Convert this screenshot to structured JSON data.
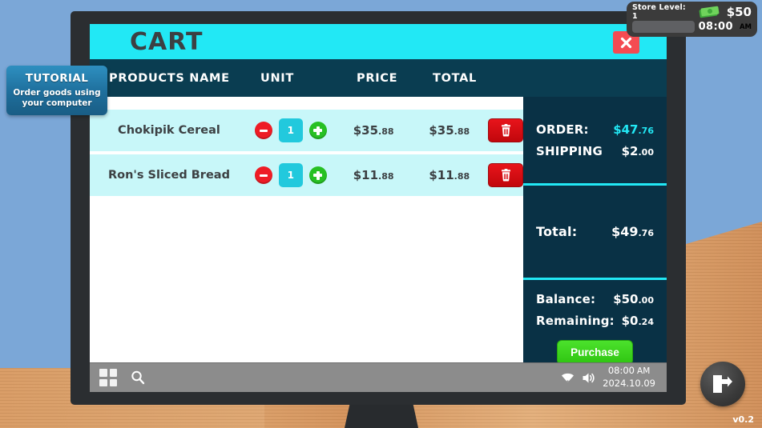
{
  "hud": {
    "store_level": "Store Level: 1",
    "money": "$50",
    "money_icon": "cash-stack-icon",
    "time": "08:00",
    "ampm": "AM",
    "progress_percent": 0
  },
  "tutorial": {
    "title": "TUTORIAL",
    "text": "Order goods using your computer"
  },
  "cart": {
    "title": "CART",
    "close_icon": "close-icon",
    "columns": {
      "name": "PRODUCTS NAME",
      "unit": "UNIT",
      "price": "PRICE",
      "total": "TOTAL"
    },
    "rows": [
      {
        "name": "Chokipik Cereal",
        "qty": "1",
        "price_dollars": "$35",
        "price_cents": ".88",
        "total_dollars": "$35",
        "total_cents": ".88",
        "minus_icon": "minus-circle-icon",
        "plus_icon": "plus-circle-icon",
        "delete_icon": "trash-icon"
      },
      {
        "name": "Ron's Sliced Bread",
        "qty": "1",
        "price_dollars": "$11",
        "price_cents": ".88",
        "total_dollars": "$11",
        "total_cents": ".88",
        "minus_icon": "minus-circle-icon",
        "plus_icon": "plus-circle-icon",
        "delete_icon": "trash-icon"
      }
    ],
    "summary": {
      "order_label": "ORDER:",
      "order_dollars": "$47",
      "order_cents": ".76",
      "shipping_label": "SHIPPING",
      "shipping_dollars": "$2",
      "shipping_cents": ".00",
      "total_label": "Total:",
      "total_dollars": "$49",
      "total_cents": ".76",
      "balance_label": "Balance:",
      "balance_dollars": "$50",
      "balance_cents": ".00",
      "remaining_label": "Remaining:",
      "remaining_dollars": "$0",
      "remaining_cents": ".24",
      "purchase_label": "Purchase",
      "accent_color": "#22E8F5"
    }
  },
  "taskbar": {
    "start_icon": "start-grid-icon",
    "search_icon": "search-icon",
    "wifi_icon": "wifi-icon",
    "volume_icon": "volume-icon",
    "time": "08:00",
    "ampm": "AM",
    "date": "2024.10.09"
  },
  "exit_button": {
    "icon": "exit-door-icon"
  },
  "version": "v0.2"
}
